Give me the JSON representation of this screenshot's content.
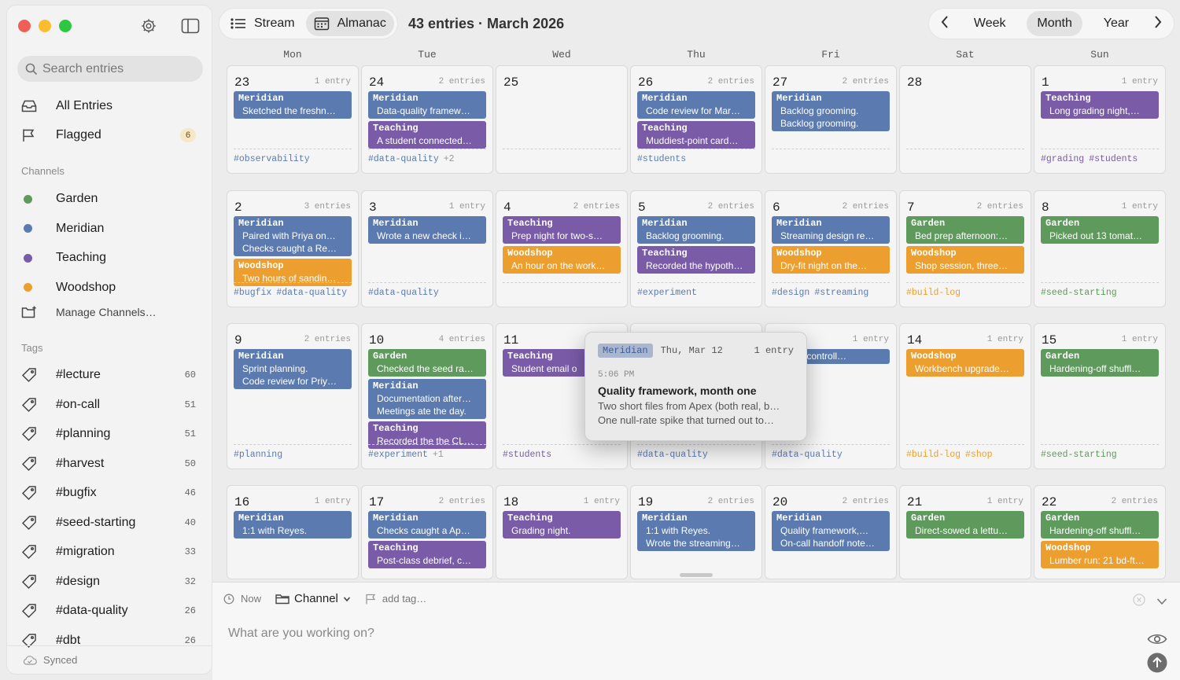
{
  "colors": {
    "Meridian": "#5a7ab0",
    "Teaching": "#7a5ba8",
    "Woodshop": "#ec9f2e",
    "Garden": "#5e9a5c",
    "traffic": [
      "#f05f57",
      "#f9bd2d",
      "#2dc840"
    ]
  },
  "sidebar": {
    "search_placeholder": "Search entries",
    "all_entries": "All Entries",
    "flagged": "Flagged",
    "flagged_count": "6",
    "channels_header": "Channels",
    "channels": [
      {
        "name": "Garden",
        "color": "#5e9a5c"
      },
      {
        "name": "Meridian",
        "color": "#5a7ab0"
      },
      {
        "name": "Teaching",
        "color": "#7a5ba8"
      },
      {
        "name": "Woodshop",
        "color": "#ec9f2e"
      }
    ],
    "manage_channels": "Manage Channels…",
    "tags_header": "Tags",
    "tags": [
      {
        "name": "#lecture",
        "count": "60"
      },
      {
        "name": "#on-call",
        "count": "51"
      },
      {
        "name": "#planning",
        "count": "51"
      },
      {
        "name": "#harvest",
        "count": "50"
      },
      {
        "name": "#bugfix",
        "count": "46"
      },
      {
        "name": "#seed-starting",
        "count": "40"
      },
      {
        "name": "#migration",
        "count": "33"
      },
      {
        "name": "#design",
        "count": "32"
      },
      {
        "name": "#data-quality",
        "count": "26"
      },
      {
        "name": "#dbt",
        "count": "26"
      }
    ],
    "status": "Synced"
  },
  "toolbar": {
    "stream": "Stream",
    "almanac": "Almanac",
    "title": "43 entries · March 2026",
    "week": "Week",
    "month": "Month",
    "year": "Year"
  },
  "calendar": {
    "weekdays": [
      "Mon",
      "Tue",
      "Wed",
      "Thu",
      "Fri",
      "Sat",
      "Sun"
    ],
    "weeks": [
      [
        {
          "day": "23",
          "count": "1 entry",
          "entries": [
            {
              "ch": "Meridian",
              "lines": [
                "Sketched the freshn…"
              ]
            }
          ],
          "tags": [
            {
              "t": "#observability",
              "c": "#5a7ab0"
            }
          ],
          "more": ""
        },
        {
          "day": "24",
          "count": "2 entries",
          "entries": [
            {
              "ch": "Meridian",
              "lines": [
                "Data-quality framew…"
              ]
            },
            {
              "ch": "Teaching",
              "lines": [
                "A student connected…"
              ]
            }
          ],
          "tags": [
            {
              "t": "#data-quality",
              "c": "#5a7ab0"
            }
          ],
          "more": "+2"
        },
        {
          "day": "25",
          "count": "",
          "entries": [],
          "tags": [],
          "more": ""
        },
        {
          "day": "26",
          "count": "2 entries",
          "entries": [
            {
              "ch": "Meridian",
              "lines": [
                "Code review for Mar…"
              ]
            },
            {
              "ch": "Teaching",
              "lines": [
                "Muddiest-point card…"
              ]
            }
          ],
          "tags": [
            {
              "t": "#students",
              "c": "#5a7ab0"
            }
          ],
          "more": ""
        },
        {
          "day": "27",
          "count": "2 entries",
          "entries": [
            {
              "ch": "Meridian",
              "lines": [
                "Backlog grooming.",
                "Backlog grooming."
              ]
            }
          ],
          "tags": [],
          "more": ""
        },
        {
          "day": "28",
          "count": "",
          "entries": [],
          "tags": [],
          "more": ""
        },
        {
          "day": "1",
          "count": "1 entry",
          "entries": [
            {
              "ch": "Teaching",
              "lines": [
                "Long grading night,…"
              ]
            }
          ],
          "tags": [
            {
              "t": "#grading",
              "c": "#7a5ba8"
            },
            {
              "t": "#students",
              "c": "#7a5ba8"
            }
          ],
          "more": ""
        }
      ],
      [
        {
          "day": "2",
          "count": "3 entries",
          "entries": [
            {
              "ch": "Meridian",
              "lines": [
                "Paired with Priya on…",
                "Checks caught a Re…"
              ]
            },
            {
              "ch": "Woodshop",
              "lines": [
                "Two hours of sandin…"
              ]
            }
          ],
          "tags": [
            {
              "t": "#bugfix",
              "c": "#5a7ab0"
            },
            {
              "t": "#data-quality",
              "c": "#5a7ab0"
            }
          ],
          "more": ""
        },
        {
          "day": "3",
          "count": "1 entry",
          "entries": [
            {
              "ch": "Meridian",
              "lines": [
                "Wrote a new check i…"
              ]
            }
          ],
          "tags": [
            {
              "t": "#data-quality",
              "c": "#5a7ab0"
            }
          ],
          "more": ""
        },
        {
          "day": "4",
          "count": "2 entries",
          "entries": [
            {
              "ch": "Teaching",
              "lines": [
                "Prep night for two-s…"
              ]
            },
            {
              "ch": "Woodshop",
              "lines": [
                "An hour on the work…"
              ]
            }
          ],
          "tags": [],
          "more": ""
        },
        {
          "day": "5",
          "count": "2 entries",
          "entries": [
            {
              "ch": "Meridian",
              "lines": [
                "Backlog grooming."
              ]
            },
            {
              "ch": "Teaching",
              "lines": [
                "Recorded the hypoth…"
              ]
            }
          ],
          "tags": [
            {
              "t": "#experiment",
              "c": "#5a7ab0"
            }
          ],
          "more": ""
        },
        {
          "day": "6",
          "count": "2 entries",
          "entries": [
            {
              "ch": "Meridian",
              "lines": [
                "Streaming design re…"
              ]
            },
            {
              "ch": "Woodshop",
              "lines": [
                "Dry-fit night on the…"
              ]
            }
          ],
          "tags": [
            {
              "t": "#design",
              "c": "#5a7ab0"
            },
            {
              "t": "#streaming",
              "c": "#5a7ab0"
            }
          ],
          "more": ""
        },
        {
          "day": "7",
          "count": "2 entries",
          "entries": [
            {
              "ch": "Garden",
              "lines": [
                "Bed prep afternoon:…"
              ]
            },
            {
              "ch": "Woodshop",
              "lines": [
                "Shop session, three…"
              ]
            }
          ],
          "tags": [
            {
              "t": "#build-log",
              "c": "#ec9f2e"
            }
          ],
          "more": ""
        },
        {
          "day": "8",
          "count": "1 entry",
          "entries": [
            {
              "ch": "Garden",
              "lines": [
                "Picked out 13 tomat…"
              ]
            }
          ],
          "tags": [
            {
              "t": "#seed-starting",
              "c": "#5e9a5c"
            }
          ],
          "more": ""
        }
      ],
      [
        {
          "day": "9",
          "count": "2 entries",
          "entries": [
            {
              "ch": "Meridian",
              "lines": [
                "Sprint planning.",
                "Code review for Priy…"
              ]
            }
          ],
          "tags": [
            {
              "t": "#planning",
              "c": "#5a7ab0"
            }
          ],
          "more": ""
        },
        {
          "day": "10",
          "count": "4 entries",
          "entries": [
            {
              "ch": "Garden",
              "lines": [
                "Checked the seed ra…"
              ]
            },
            {
              "ch": "Meridian",
              "lines": [
                "Documentation after…",
                "Meetings ate the day."
              ]
            },
            {
              "ch": "Teaching",
              "lines": [
                "Recorded the the CL…"
              ]
            }
          ],
          "tags": [
            {
              "t": "#experiment",
              "c": "#5a7ab0"
            }
          ],
          "more": "+1"
        },
        {
          "day": "11",
          "count": "",
          "entries": [
            {
              "ch": "Teaching",
              "lines": [
                "Student email o"
              ]
            }
          ],
          "tags": [
            {
              "t": "#students",
              "c": "#7a5ba8"
            }
          ],
          "more": ""
        },
        {
          "day": "",
          "count": "",
          "entries": [],
          "tags": [
            {
              "t": "#data-quality",
              "c": "#5a7ab0"
            }
          ],
          "more": ""
        },
        {
          "day": "",
          "count": "1 entry",
          "entries": [
            {
              "ch": "",
              "lines": [
                "th the controll…"
              ]
            }
          ],
          "tags": [
            {
              "t": "#data-quality",
              "c": "#5a7ab0"
            }
          ],
          "more": ""
        },
        {
          "day": "14",
          "count": "1 entry",
          "entries": [
            {
              "ch": "Woodshop",
              "lines": [
                "Workbench upgrade…"
              ]
            }
          ],
          "tags": [
            {
              "t": "#build-log",
              "c": "#ec9f2e"
            },
            {
              "t": "#shop",
              "c": "#ec9f2e"
            }
          ],
          "more": ""
        },
        {
          "day": "15",
          "count": "1 entry",
          "entries": [
            {
              "ch": "Garden",
              "lines": [
                "Hardening-off shuffl…"
              ]
            }
          ],
          "tags": [
            {
              "t": "#seed-starting",
              "c": "#5e9a5c"
            }
          ],
          "more": ""
        }
      ],
      [
        {
          "day": "16",
          "count": "1 entry",
          "entries": [
            {
              "ch": "Meridian",
              "lines": [
                "1:1 with Reyes."
              ]
            }
          ],
          "tags": [],
          "more": ""
        },
        {
          "day": "17",
          "count": "2 entries",
          "entries": [
            {
              "ch": "Meridian",
              "lines": [
                "Checks caught a Ap…"
              ]
            },
            {
              "ch": "Teaching",
              "lines": [
                "Post-class debrief, c…"
              ]
            }
          ],
          "tags": [],
          "more": ""
        },
        {
          "day": "18",
          "count": "1 entry",
          "entries": [
            {
              "ch": "Teaching",
              "lines": [
                "Grading night."
              ]
            }
          ],
          "tags": [],
          "more": ""
        },
        {
          "day": "19",
          "count": "2 entries",
          "entries": [
            {
              "ch": "Meridian",
              "lines": [
                "1:1 with Reyes.",
                "Wrote the streaming…"
              ]
            }
          ],
          "tags": [],
          "more": ""
        },
        {
          "day": "20",
          "count": "2 entries",
          "entries": [
            {
              "ch": "Meridian",
              "lines": [
                "Quality framework,…",
                "On-call handoff note…"
              ]
            }
          ],
          "tags": [],
          "more": ""
        },
        {
          "day": "21",
          "count": "1 entry",
          "entries": [
            {
              "ch": "Garden",
              "lines": [
                "Direct-sowed a lettu…"
              ]
            }
          ],
          "tags": [],
          "more": ""
        },
        {
          "day": "22",
          "count": "2 entries",
          "entries": [
            {
              "ch": "Garden",
              "lines": [
                "Hardening-off shuffl…"
              ]
            },
            {
              "ch": "Woodshop",
              "lines": [
                "Lumber run: 21 bd-ft…"
              ]
            }
          ],
          "tags": [],
          "more": ""
        }
      ]
    ]
  },
  "popover": {
    "channel": "Meridian",
    "date": "Thu, Mar 12",
    "count": "1 entry",
    "time": "5:06 PM",
    "title": "Quality framework, month one",
    "line1": "Two short files from Apex (both real, b…",
    "line2": "One null-rate spike that turned out to…"
  },
  "composer": {
    "now": "Now",
    "channel": "Channel",
    "add_tag": "add tag…",
    "placeholder": "What are you working on?"
  }
}
